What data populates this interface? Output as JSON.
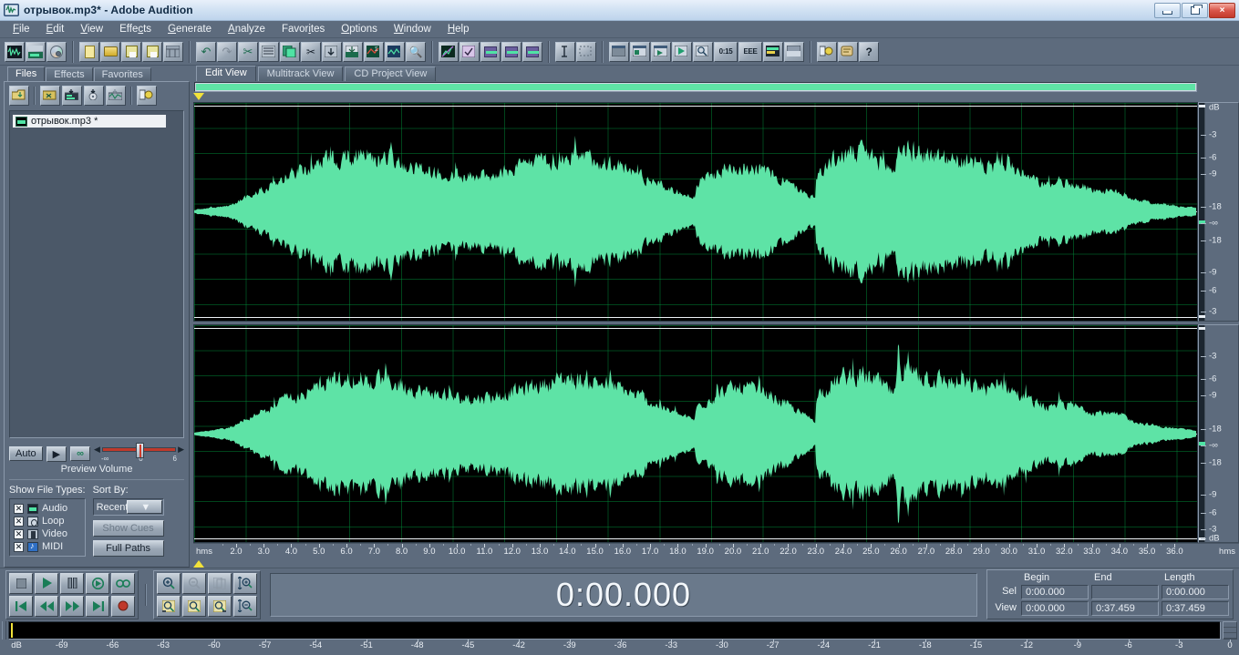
{
  "window": {
    "title": "отрывок.mp3* - Adobe Audition",
    "app_icon": "audition-waveform-icon",
    "minimize_label": "Minimize",
    "restore_label": "Restore",
    "close_label": "×"
  },
  "menu": [
    {
      "label": "File",
      "accel": "F"
    },
    {
      "label": "Edit",
      "accel": "E"
    },
    {
      "label": "View",
      "accel": "V"
    },
    {
      "label": "Effects",
      "accel": "c"
    },
    {
      "label": "Generate",
      "accel": "G"
    },
    {
      "label": "Analyze",
      "accel": "A"
    },
    {
      "label": "Favorites",
      "accel": "i"
    },
    {
      "label": "Options",
      "accel": "O"
    },
    {
      "label": "Window",
      "accel": "W"
    },
    {
      "label": "Help",
      "accel": "H"
    }
  ],
  "toolbar": {
    "groups": [
      {
        "name": "view-mode",
        "buttons": [
          {
            "icon": "edit-view-waveform-icon",
            "label": ""
          },
          {
            "icon": "multitrack-view-icon",
            "label": ""
          },
          {
            "icon": "cd-project-view-icon",
            "label": ""
          }
        ]
      },
      {
        "name": "file-ops",
        "buttons": [
          {
            "icon": "new-file-icon",
            "label": ""
          },
          {
            "icon": "open-file-icon",
            "label": ""
          },
          {
            "icon": "save-file-icon",
            "label": ""
          },
          {
            "icon": "save-as-icon",
            "label": ""
          },
          {
            "icon": "close-file-icon",
            "label": ""
          }
        ]
      },
      {
        "name": "edit-ops",
        "buttons": [
          {
            "icon": "undo-icon",
            "label": ""
          },
          {
            "icon": "redo-icon",
            "label": ""
          },
          {
            "icon": "cut-tool-icon",
            "label": ""
          },
          {
            "icon": "mixdown-icon",
            "label": ""
          },
          {
            "icon": "copy-icon",
            "label": ""
          },
          {
            "icon": "cut-icon",
            "label": ""
          },
          {
            "icon": "paste-icon",
            "label": ""
          },
          {
            "icon": "mix-paste-icon",
            "label": ""
          },
          {
            "icon": "trim-icon",
            "label": ""
          },
          {
            "icon": "insert-multitrack-icon",
            "label": ""
          },
          {
            "icon": "scan-icon",
            "label": ""
          }
        ]
      },
      {
        "name": "analysis",
        "buttons": [
          {
            "icon": "amplitude-graph-icon",
            "label": ""
          },
          {
            "icon": "checkbox-tool-icon",
            "label": ""
          },
          {
            "icon": "spectral-frequency-icon",
            "label": ""
          },
          {
            "icon": "spectral-pan-icon",
            "label": ""
          },
          {
            "icon": "spectral-phase-icon",
            "label": ""
          }
        ]
      },
      {
        "name": "selection-tools",
        "buttons": [
          {
            "icon": "time-selection-icon",
            "label": ""
          },
          {
            "icon": "marquee-selection-icon",
            "label": ""
          }
        ]
      },
      {
        "name": "panels",
        "buttons": [
          {
            "icon": "window-panel-icon",
            "label": ""
          },
          {
            "icon": "organizer-window-icon",
            "label": ""
          },
          {
            "icon": "transport-window-icon",
            "label": ""
          },
          {
            "icon": "play-window-icon",
            "label": ""
          },
          {
            "icon": "zoom-window-icon",
            "label": ""
          },
          {
            "icon": "time-window-icon",
            "label": "0:15"
          },
          {
            "icon": "selection-view-window-icon",
            "label": "EEE"
          },
          {
            "icon": "level-meters-icon",
            "label": ""
          },
          {
            "icon": "placement-icon",
            "label": ""
          }
        ]
      },
      {
        "name": "help-group",
        "buttons": [
          {
            "icon": "options-settings-icon",
            "label": ""
          },
          {
            "icon": "script-icon",
            "label": ""
          },
          {
            "icon": "help-icon",
            "label": "?"
          }
        ]
      }
    ]
  },
  "view_tabs": [
    {
      "label": "Edit View",
      "active": true
    },
    {
      "label": "Multitrack View",
      "active": false
    },
    {
      "label": "CD Project View",
      "active": false
    }
  ],
  "left_panel": {
    "tabs": [
      {
        "label": "Files",
        "active": true
      },
      {
        "label": "Effects",
        "active": false
      },
      {
        "label": "Favorites",
        "active": false
      }
    ],
    "toolbar_buttons": [
      {
        "icon": "open-file-icon"
      },
      {
        "icon": "close-file-icon"
      },
      {
        "icon": "insert-into-multitrack-icon"
      },
      {
        "icon": "insert-into-cd-list-icon"
      },
      {
        "icon": "insert-into-playlist-icon"
      },
      {
        "icon": "file-options-icon"
      }
    ],
    "files": [
      {
        "name": "отрывок.mp3 *",
        "icon": "waveform-file-icon",
        "selected": true
      }
    ],
    "preview": {
      "auto_label": "Auto",
      "play_label": "▶",
      "loop_label": "∞",
      "volume_title": "Preview Volume",
      "volume_min": "-∞",
      "volume_mid": "0",
      "volume_max": "6",
      "volume_value": 46
    },
    "show_file_types": {
      "title": "Show File Types:",
      "items": [
        {
          "label": "Audio",
          "checked": true,
          "icon": "audio-type-icon"
        },
        {
          "label": "Loop",
          "checked": true,
          "icon": "loop-type-icon"
        },
        {
          "label": "Video",
          "checked": true,
          "icon": "video-type-icon"
        },
        {
          "label": "MIDI",
          "checked": true,
          "icon": "midi-type-icon"
        }
      ]
    },
    "sort_by": {
      "title": "Sort By:",
      "value": "Recent Acce",
      "show_cues_label": "Show Cues",
      "full_paths_label": "Full Paths"
    }
  },
  "waveform": {
    "db_labels_top": [
      "dB",
      "-3",
      "-6",
      "-9",
      "-18",
      "-∞",
      "-18",
      "-9",
      "-6",
      "-3"
    ],
    "db_labels_bottom": [
      "",
      "-3",
      "-6",
      "-9",
      "-18",
      "-∞",
      "-18",
      "-9",
      "-6",
      "-3",
      "dB"
    ],
    "wave_color": "#5ee3a6",
    "grid_color": "#00963c",
    "background": "#000000",
    "ruler_unit": "hms",
    "ruler_start": 1.0,
    "ruler_end": 36.0,
    "ruler_labels": [
      "2.0",
      "3.0",
      "4.0",
      "5.0",
      "6.0",
      "7.0",
      "8.0",
      "9.0",
      "10.0",
      "11.0",
      "12.0",
      "13.0",
      "14.0",
      "15.0",
      "16.0",
      "17.0",
      "18.0",
      "19.0",
      "20.0",
      "21.0",
      "22.0",
      "23.0",
      "24.0",
      "25.0",
      "26.0",
      "27.0",
      "28.0",
      "29.0",
      "30.0",
      "31.0",
      "32.0",
      "33.0",
      "34.0",
      "35.0",
      "36.0"
    ]
  },
  "transport": {
    "buttons_row1": [
      {
        "name": "stop-button",
        "glyph": "■"
      },
      {
        "name": "play-button",
        "glyph": "▶"
      },
      {
        "name": "pause-button",
        "glyph": "❚❚"
      },
      {
        "name": "play-to-end-button",
        "glyph": "◑"
      },
      {
        "name": "loop-play-button",
        "glyph": "∞"
      }
    ],
    "buttons_row2": [
      {
        "name": "go-to-beginning-button",
        "glyph": "|◀"
      },
      {
        "name": "rewind-button",
        "glyph": "◀◀"
      },
      {
        "name": "fast-forward-button",
        "glyph": "▶▶"
      },
      {
        "name": "go-to-end-button",
        "glyph": "▶|"
      },
      {
        "name": "record-button",
        "glyph": "●"
      }
    ],
    "zoom_row1": [
      {
        "name": "zoom-in-horizontal-button",
        "glyph": "⊕"
      },
      {
        "name": "zoom-out-horizontal-button",
        "glyph": "⊖"
      },
      {
        "name": "zoom-out-full-button",
        "glyph": "⧉"
      }
    ],
    "zoom_row2": [
      {
        "name": "zoom-to-selection-left-button",
        "glyph": "◱"
      },
      {
        "name": "zoom-to-selection-button",
        "glyph": "◰"
      },
      {
        "name": "zoom-to-selection-right-button",
        "glyph": "◲"
      }
    ],
    "zoom_vert": [
      {
        "name": "zoom-in-vertical-button",
        "glyph": "⇕⊕"
      },
      {
        "name": "zoom-out-vertical-button",
        "glyph": "⇕⊖"
      }
    ],
    "time_display": "0:00.000"
  },
  "selection_view": {
    "headers": [
      "Begin",
      "End",
      "Length"
    ],
    "rows": [
      {
        "label": "Sel",
        "begin": "0:00.000",
        "end": "",
        "length": "0:00.000"
      },
      {
        "label": "View",
        "begin": "0:00.000",
        "end": "0:37.459",
        "length": "0:37.459"
      }
    ]
  },
  "level_meter": {
    "unit": "dB",
    "labels": [
      "-69",
      "-66",
      "-63",
      "-60",
      "-57",
      "-54",
      "-51",
      "-48",
      "-45",
      "-42",
      "-39",
      "-36",
      "-33",
      "-30",
      "-27",
      "-24",
      "-21",
      "-18",
      "-15",
      "-12",
      "-9",
      "-6",
      "-3",
      "0"
    ],
    "min": -72,
    "max": 0
  }
}
